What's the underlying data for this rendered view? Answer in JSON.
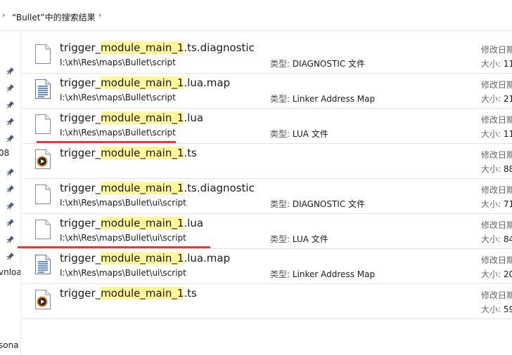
{
  "breadcrumb": {
    "chevron_left": "›",
    "title": "“Bullet”中的搜索结果",
    "chevron_right": "›"
  },
  "nav": {
    "pins": 11,
    "clip_08": "08",
    "clip_nloa": "vnloa",
    "clip_sona": "sona"
  },
  "highlight_term": "module_main_1",
  "labels": {
    "type": "类型:",
    "date": "修改日期",
    "size": "大小:"
  },
  "files": [
    {
      "prefix": "trigger_",
      "hl": "module_main_1",
      "suffix": ".ts.diagnostic",
      "icon": "blank-file-icon",
      "path": "I:\\xh\\Res\\maps\\Bullet\\script",
      "type": "DIAGNOSTIC 文件",
      "size_hint": "11"
    },
    {
      "prefix": "trigger_",
      "hl": "module_main_1",
      "suffix": ".lua.map",
      "icon": "text-file-icon",
      "path": "I:\\xh\\Res\\maps\\Bullet\\script",
      "type": "Linker Address Map",
      "size_hint": "21"
    },
    {
      "prefix": "trigger_",
      "hl": "module_main_1",
      "suffix": ".lua",
      "icon": "blank-file-icon",
      "path": "I:\\xh\\Res\\maps\\Bullet\\script",
      "type": "LUA 文件",
      "size_hint": "11"
    },
    {
      "prefix": "trigger_",
      "hl": "module_main_1",
      "suffix": ".ts",
      "icon": "media-file-icon",
      "path": "",
      "type": "",
      "size_hint": "88"
    },
    {
      "prefix": "trigger_",
      "hl": "module_main_1",
      "suffix": ".ts.diagnostic",
      "icon": "blank-file-icon",
      "path": "I:\\xh\\Res\\maps\\Bullet\\ui\\script",
      "type": "DIAGNOSTIC 文件",
      "size_hint": "71"
    },
    {
      "prefix": "trigger_",
      "hl": "module_main_1",
      "suffix": ".lua",
      "icon": "blank-file-icon",
      "path": "I:\\xh\\Res\\maps\\Bullet\\ui\\script",
      "type": "LUA 文件",
      "size_hint": "84"
    },
    {
      "prefix": "trigger_",
      "hl": "module_main_1",
      "suffix": ".lua.map",
      "icon": "text-file-icon",
      "path": "I:\\xh\\Res\\maps\\Bullet\\ui\\script",
      "type": "Linker Address Map",
      "size_hint": "20"
    },
    {
      "prefix": "trigger_",
      "hl": "module_main_1",
      "suffix": ".ts",
      "icon": "media-file-icon",
      "path": "",
      "type": "",
      "size_hint": "59"
    }
  ],
  "colors": {
    "highlight": "#fff799",
    "underline": "#e23b3b",
    "pin": "#4a5b73",
    "text_doc_lines": "#2f5fb3"
  }
}
